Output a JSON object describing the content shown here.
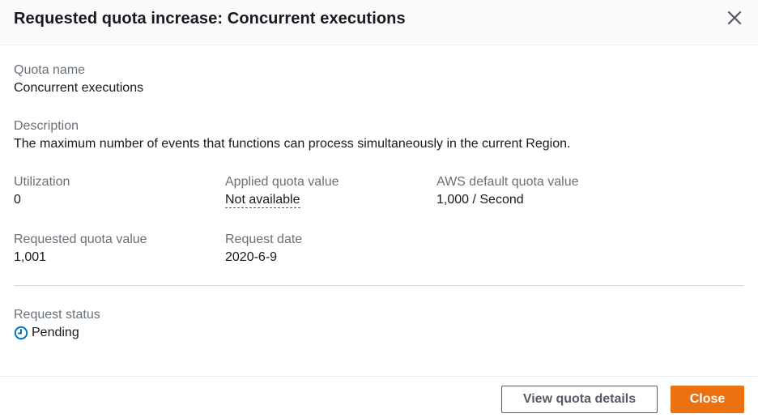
{
  "modal": {
    "title": "Requested quota increase: Concurrent executions",
    "close_icon": "close-icon"
  },
  "quota_name": {
    "label": "Quota name",
    "value": "Concurrent executions"
  },
  "description": {
    "label": "Description",
    "value": "The maximum number of events that functions can process simultaneously in the current Region."
  },
  "utilization": {
    "label": "Utilization",
    "value": "0"
  },
  "applied_quota": {
    "label": "Applied quota value",
    "value": "Not available"
  },
  "aws_default_quota": {
    "label": "AWS default quota value",
    "value": "1,000 / Second"
  },
  "requested_quota": {
    "label": "Requested quota value",
    "value": "1,001"
  },
  "request_date": {
    "label": "Request date",
    "value": "2020-6-9"
  },
  "request_status": {
    "label": "Request status",
    "value": "Pending",
    "icon": "clock-icon",
    "color": "#0073bb"
  },
  "footer": {
    "view_details_label": "View quota details",
    "close_label": "Close"
  },
  "colors": {
    "primary": "#ec7211",
    "label_gray": "#687078",
    "text": "#16191f"
  }
}
